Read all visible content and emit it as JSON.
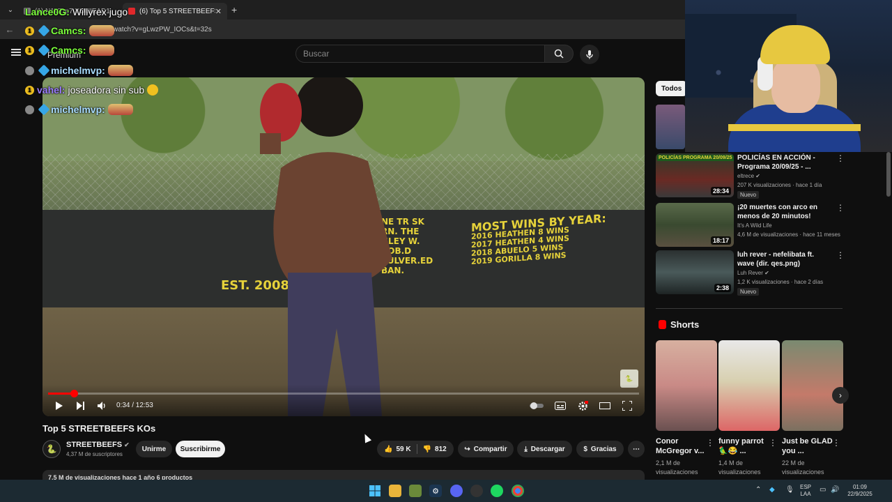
{
  "browser": {
    "tabs": [
      {
        "label": "(1) N1VTrp7 YOUIEAD1 stream",
        "active": false
      },
      {
        "label": "(6) Top 5 STREETBEEFS KOs - Yo",
        "active": true
      }
    ],
    "new_tab": "+",
    "url": "watch?v=gLwzPW_IOCs&t=32s"
  },
  "youtube": {
    "header": {
      "logo_text": "Premium",
      "search_placeholder": "Buscar"
    },
    "player": {
      "time": "0:34 / 12:53",
      "progress": 0.044,
      "sign_est": "EST. 2008",
      "sign_wins_title": "MOST WINS BY YEAR:",
      "sign_wins": [
        "2016 HEATHEN 8 WINS",
        "2017 HEATHEN 4 WINS",
        "2018 ABUELO 5 WINS",
        "2019 GORILLA 8 WINS"
      ],
      "sign_names": [
        "NE TR SK",
        "RN. THE",
        "HLEY W.",
        "ROB.D",
        "PULVER.ED",
        "BAN."
      ]
    },
    "video": {
      "title": "Top 5 STREETBEEFS KOs",
      "channel": "STREETBEEFS",
      "subscribers": "4,37 M de suscriptores",
      "join": "Unirme",
      "subscribe": "Suscribirme",
      "likes": "59 K",
      "dislikes": "812",
      "share": "Compartir",
      "download": "Descargar",
      "thanks": "Gracias",
      "more": "⋯",
      "description_preview": "7,5 M de visualizaciones  hace 1 año  6 productos"
    },
    "sidebar": {
      "chip": "Todos",
      "recommendations": [
        {
          "title": "POLICÍAS EN ACCIÓN - Programa 20/09/25 - ...",
          "channel": "eltrece",
          "meta": "207 K visualizaciones · hace 1 día",
          "duration": "28:34",
          "badge": "Nuevo",
          "thumb_text": "POLICÍAS PROGRAMA 20/09/25"
        },
        {
          "title": "¡20 muertes con arco en menos de 20 minutos! Recopilación ...",
          "channel": "It's A Wild Life",
          "meta": "4,6 M de visualizaciones · hace 11 meses",
          "duration": "18:17",
          "badge": "",
          "thumb_text": ""
        },
        {
          "title": "luh rever - nefelibata ft. wave (dir. qes.png)",
          "channel": "Luh Rever",
          "meta": "1,2 K visualizaciones · hace 2 días",
          "duration": "2:38",
          "badge": "Nuevo",
          "thumb_text": ""
        }
      ],
      "shorts_title": "Shorts",
      "shorts": [
        {
          "title": "Conor McGregor v...",
          "views": "2,1 M de visualizaciones"
        },
        {
          "title": "funny parrot 🦜😂 ...",
          "views": "1,4 M de visualizaciones"
        },
        {
          "title": "Just be GLAD you ...",
          "views": "22 M de visualizaciones"
        }
      ]
    }
  },
  "chat": [
    {
      "user": "Lance0G:",
      "text": "Willyrex jugo",
      "color": "#7cff3c",
      "badge": "",
      "gem": false,
      "emote": false
    },
    {
      "user": "Camcs:",
      "text": "",
      "color": "#7cff3c",
      "badge": "1",
      "gem": true,
      "emote": true
    },
    {
      "user": "Camcs:",
      "text": "",
      "color": "#7cff3c",
      "badge": "1",
      "gem": true,
      "emote": true
    },
    {
      "user": "michelmvp:",
      "text": "",
      "color": "#a9dcff",
      "badge": "grey",
      "gem": true,
      "emote": true
    },
    {
      "user": "vahel:",
      "text": "joseadora sin sub",
      "color": "#9b7cff",
      "badge": "1",
      "gem": false,
      "emote": false
    },
    {
      "user": "michelmvp:",
      "text": "",
      "color": "#a9dcff",
      "badge": "grey",
      "gem": true,
      "emote": true
    }
  ],
  "taskbar": {
    "lang": "ESP",
    "lang2": "LAA",
    "time": "01:09",
    "date": "22/9/2025"
  },
  "colors": {
    "accent": "#ff0000",
    "chip_bg": "#f1f1f1",
    "sign_yellow": "#e6d23a"
  }
}
